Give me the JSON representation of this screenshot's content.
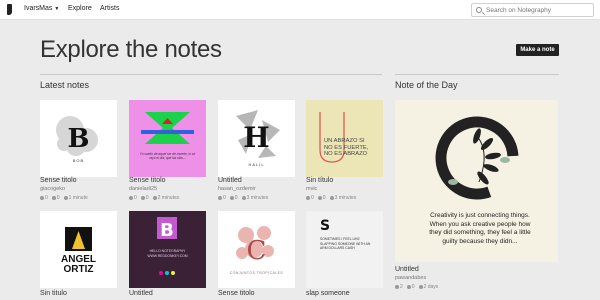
{
  "nav": {
    "user": "IvarsMas",
    "explore": "Explore",
    "artists": "Artists"
  },
  "search": {
    "placeholder": "Search on Notegraphy"
  },
  "page": {
    "title": "Explore the notes",
    "make_note": "Make a note"
  },
  "sections": {
    "latest": "Latest notes",
    "note_of_day": "Note of the Day"
  },
  "notes": [
    {
      "title": "Sense titolo",
      "user": "giacogeko",
      "likes": "0",
      "comments": "0",
      "time": "1 minute",
      "text": "BOB"
    },
    {
      "title": "Sense titolo",
      "user": "danieladi25",
      "likes": "0",
      "comments": "0",
      "time": "2 minutes",
      "text": "Yo sueño de aquel ser de muerte, ni se rayó el día, que las olas..."
    },
    {
      "title": "Untitled",
      "user": "hasan_ozdemir",
      "likes": "0",
      "comments": "0",
      "time": "3 minutes",
      "text": "HALİL"
    },
    {
      "title": "Sin título",
      "user": "mvic",
      "likes": "0",
      "comments": "0",
      "time": "3 minutes",
      "text": "UN ABRAZO SI NO ES FUERTE, NO ES ABRAZO"
    },
    {
      "title": "Sin titulo",
      "line1": "ANGEL",
      "line2": "ORTIZ"
    },
    {
      "title": "Untitled",
      "text": "HELLO NOTEGRAPHY WWW.REDDONKEY.COM"
    },
    {
      "title": "Sense titolo",
      "text": "CONJUNTOS TROPICALES"
    },
    {
      "title": "slap someone",
      "text": "SOMETIMES I FEEL LIKE SLAPPING SOMEONE WITH AN ARM DOLLARS CASH"
    }
  ],
  "note_of_day": {
    "title": "Untitled",
    "user": "pawandabes",
    "likes": "2",
    "comments": "0",
    "time": "2 days",
    "quote": "Creativity is just connecting things. When you ask creative people how they did something, they feel a little guilty because they didn...",
    "letter": "C"
  },
  "colors": {
    "accent": "#222222",
    "background": "#ebebeb"
  }
}
